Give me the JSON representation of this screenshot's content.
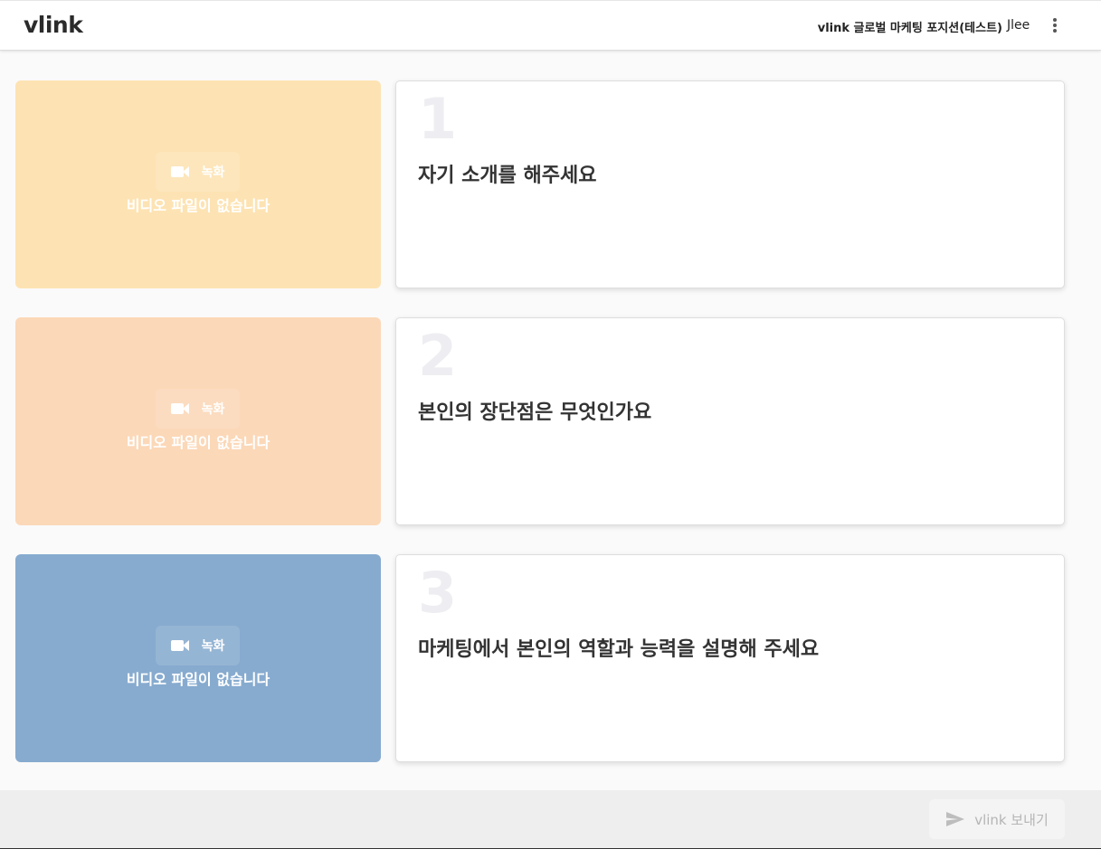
{
  "header": {
    "logo": "vlink",
    "position_title": "vlink 글로벌 마케팅 포지션(테스트)",
    "user_name": "Jlee",
    "menu_icon": "more-vertical-icon"
  },
  "questions": [
    {
      "number": "1",
      "text": "자기 소개를 해주세요",
      "video_color": "#fde3b3",
      "record_label": "녹화",
      "no_video_text": "비디오 파일이 없습니다"
    },
    {
      "number": "2",
      "text": "본인의 장단점은 무엇인가요",
      "video_color": "#fbd8b8",
      "record_label": "녹화",
      "no_video_text": "비디오 파일이 없습니다"
    },
    {
      "number": "3",
      "text": "마케팅에서 본인의 역할과 능력을 설명해 주세요",
      "video_color": "#87abcf",
      "record_label": "녹화",
      "no_video_text": "비디오 파일이 없습니다"
    }
  ],
  "footer": {
    "send_label": "vlink 보내기",
    "send_icon": "send-icon"
  }
}
